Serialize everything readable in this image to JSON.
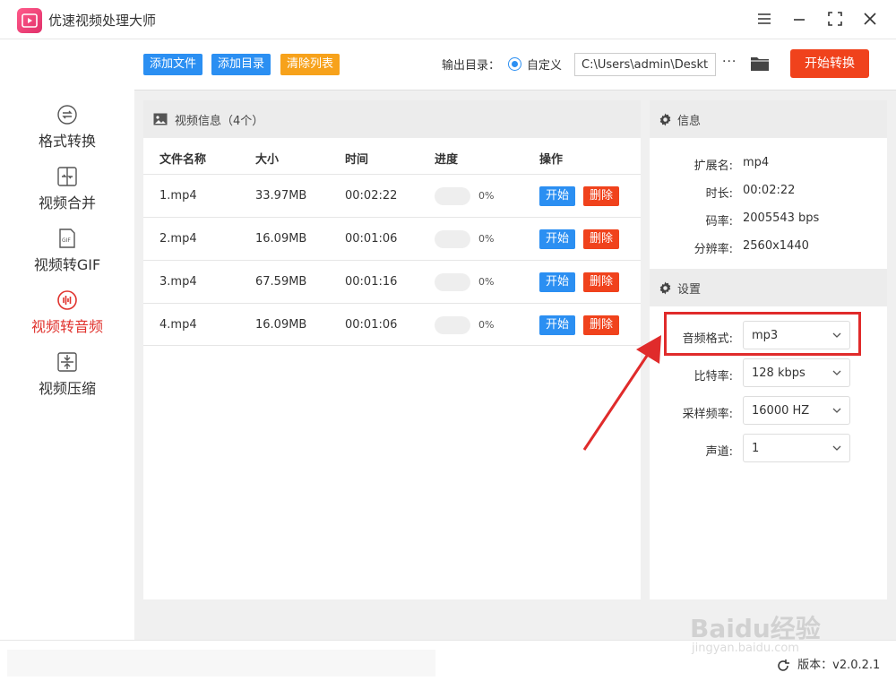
{
  "app": {
    "title": "优速视频处理大师",
    "accent": "#2b8ff2",
    "danger": "#f0421c",
    "active_color": "#e0332e"
  },
  "sidebar": {
    "items": [
      {
        "label": "格式转换",
        "icon": "format-convert-icon",
        "active": false
      },
      {
        "label": "视频合并",
        "icon": "video-merge-icon",
        "active": false
      },
      {
        "label": "视频转GIF",
        "icon": "gif-icon",
        "active": false
      },
      {
        "label": "视频转音频",
        "icon": "audio-icon",
        "active": true
      },
      {
        "label": "视频压缩",
        "icon": "compress-icon",
        "active": false
      }
    ]
  },
  "toolbar": {
    "add_file": "添加文件",
    "add_folder": "添加目录",
    "clear_list": "清除列表",
    "output_label": "输出目录：",
    "radio_label": "自定义",
    "output_path": "C:\\Users\\admin\\Deskto",
    "more": "···",
    "start_all": "开始转换"
  },
  "video_panel": {
    "title": "视频信息（4个）",
    "columns": [
      "文件名称",
      "大小",
      "时间",
      "进度",
      "操作"
    ],
    "rows": [
      {
        "name": "1.mp4",
        "size": "33.97MB",
        "time": "00:02:22",
        "progress": "0%",
        "start": "开始",
        "delete": "删除"
      },
      {
        "name": "2.mp4",
        "size": "16.09MB",
        "time": "00:01:06",
        "progress": "0%",
        "start": "开始",
        "delete": "删除"
      },
      {
        "name": "3.mp4",
        "size": "67.59MB",
        "time": "00:01:16",
        "progress": "0%",
        "start": "开始",
        "delete": "删除"
      },
      {
        "name": "4.mp4",
        "size": "16.09MB",
        "time": "00:01:06",
        "progress": "0%",
        "start": "开始",
        "delete": "删除"
      }
    ]
  },
  "info_panel": {
    "title": "信息",
    "items": [
      {
        "key": "扩展名:",
        "value": "mp4"
      },
      {
        "key": "时长:",
        "value": "00:02:22"
      },
      {
        "key": "码率:",
        "value": "2005543 bps"
      },
      {
        "key": "分辨率:",
        "value": "2560x1440"
      }
    ]
  },
  "settings_panel": {
    "title": "设置",
    "items": [
      {
        "key": "音频格式:",
        "value": "mp3"
      },
      {
        "key": "比特率:",
        "value": "128 kbps"
      },
      {
        "key": "采样频率:",
        "value": "16000 HZ"
      },
      {
        "key": "声道:",
        "value": "1"
      }
    ]
  },
  "status": {
    "version_label": "版本：",
    "version": "v2.0.2.1"
  },
  "watermark": {
    "text": "Baidu经验",
    "sub": "jingyan.baidu.com"
  }
}
